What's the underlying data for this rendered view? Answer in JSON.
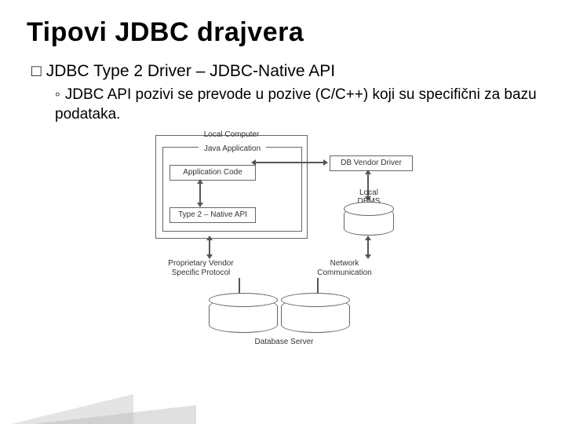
{
  "title": "Tipovi JDBC drajvera",
  "bullet1_prefix": "JDBC",
  "bullet1_rest": " Type 2 Driver – JDBC-Native API",
  "bullet2": "JDBC API pozivi se prevode u pozive (C/C++) koji su specifični za bazu podataka.",
  "diagram": {
    "local_computer": "Local Computer",
    "java_application": "Java Application",
    "application_code": "Application Code",
    "type2": "Type 2 – Native API",
    "db_vendor_driver": "DB Vendor Driver",
    "local_dbms": "Local\nDBMS",
    "proprietary": "Proprietary Vendor\nSpecific Protocol",
    "network": "Network\nCommunication",
    "database_server": "Database Server"
  }
}
